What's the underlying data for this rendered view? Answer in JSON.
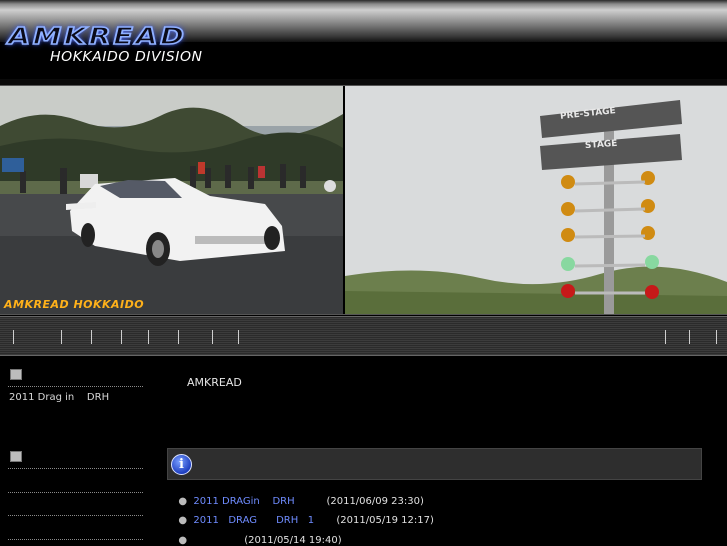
{
  "header": {
    "logo_text": "AMKREAD",
    "subtitle": "HOKKAIDO DIVISION"
  },
  "banner": {
    "left_photo_caption": "AMKREAD  HOKKAIDO",
    "right_photo_signs": [
      "PRE-STAGE",
      "STAGE"
    ]
  },
  "nav": {
    "left_separators": 8,
    "right_separators": 3
  },
  "sidebar": {
    "sections": [
      {
        "items": [
          "2011 Drag in    DRH"
        ]
      },
      {
        "items": [
          "",
          "",
          ""
        ]
      }
    ]
  },
  "main": {
    "title": "AMKREAD",
    "news": [
      {
        "link": "2011 DRAGin    DRH",
        "date": "(2011/06/09 23:30)"
      },
      {
        "link": "2011   DRAG      DRH   1",
        "date": "(2011/05/19 12:17)"
      },
      {
        "link": "",
        "date": "(2011/05/14 19:40)"
      }
    ]
  },
  "colors": {
    "link": "#6f8cff",
    "caption": "#ffb11a",
    "logo_outline": "#8fb0ff"
  }
}
